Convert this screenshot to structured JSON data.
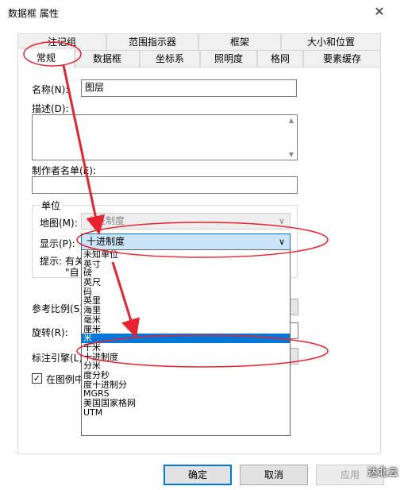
{
  "window": {
    "title": "数据框 属性",
    "close_glyph": "✕"
  },
  "tabs_row1": [
    "注记组",
    "范围指示器",
    "框架",
    "大小和位置"
  ],
  "tabs_row2": [
    "常规",
    "数据框",
    "坐标系",
    "照明度",
    "格网",
    "要素缓存"
  ],
  "fields": {
    "name_label": "名称(N):",
    "name_value": "图层",
    "desc_label": "描述(D):",
    "creator_label": "制作者名单(E):"
  },
  "units": {
    "group_label": "单位",
    "map_label": "地图(M):",
    "map_value": "十进制度",
    "display_label": "显示(P):",
    "display_value": "十进制度",
    "hint_label": "提示:",
    "hint_text": "有关",
    "hint_text2": "\"自"
  },
  "other": {
    "ref_scale_label": "参考比例(S)",
    "rotation_label": "旋转(R):",
    "label_engine_label": "标注引擎(L)",
    "legend_check_label": "在图例中",
    "check_glyph": "✓"
  },
  "dropdown_options": [
    "未知单位",
    "英寸",
    "磅",
    "英尺",
    "码",
    "英里",
    "海里",
    "毫米",
    "厘米",
    "米",
    "千米",
    "十进制度",
    "分米",
    "度分秒",
    "度十进制分",
    "MGRS",
    "美国国家格网",
    "UTM"
  ],
  "dropdown_selected": "米",
  "buttons": {
    "ok": "确定",
    "cancel": "取消",
    "apply": "应用"
  },
  "watermark": "达北云",
  "colors": {
    "annotation": "#e8222e",
    "selection": "#0078d7"
  }
}
